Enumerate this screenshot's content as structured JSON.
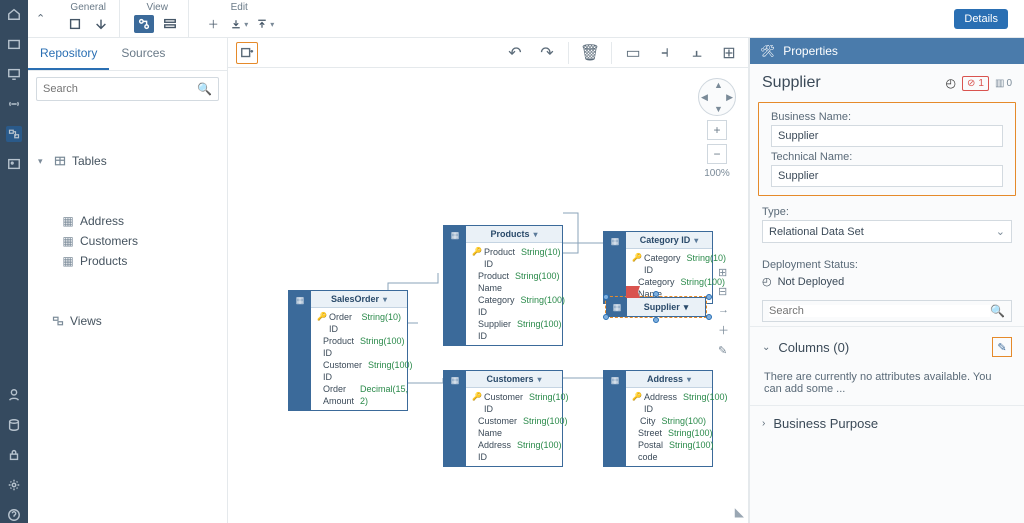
{
  "ribbon": {
    "groups": [
      {
        "label": "General",
        "expanded": true
      },
      {
        "label": "View"
      },
      {
        "label": "Edit"
      }
    ],
    "details_btn": "Details"
  },
  "sidebar": {
    "tabs": [
      "Repository",
      "Sources"
    ],
    "active_tab": 0,
    "search_placeholder": "Search",
    "tree": {
      "tables_label": "Tables",
      "tables": [
        "Address",
        "Customers",
        "Products"
      ],
      "views_label": "Views"
    }
  },
  "canvas": {
    "zoom": "100%",
    "entities": {
      "salesorder": {
        "title": "SalesOrder",
        "cols": [
          [
            "Order ID",
            "String(10)",
            true
          ],
          [
            "Product ID",
            "String(100)",
            false
          ],
          [
            "Customer ID",
            "String(100)",
            false
          ],
          [
            "Order Amount",
            "Decimal(15, 2)",
            false
          ]
        ]
      },
      "products": {
        "title": "Products",
        "cols": [
          [
            "Product ID",
            "String(10)",
            true
          ],
          [
            "Product Name",
            "String(100)",
            false
          ],
          [
            "Category ID",
            "String(100)",
            false
          ],
          [
            "Supplier ID",
            "String(100)",
            false
          ]
        ]
      },
      "customers": {
        "title": "Customers",
        "cols": [
          [
            "Customer ID",
            "String(10)",
            true
          ],
          [
            "Customer Name",
            "String(100)",
            false
          ],
          [
            "Address ID",
            "String(100)",
            false
          ]
        ]
      },
      "category": {
        "title": "Category ID",
        "cols": [
          [
            "Category ID",
            "String(10)",
            true
          ],
          [
            "Category Name",
            "String(100)",
            false
          ]
        ]
      },
      "address": {
        "title": "Address",
        "cols": [
          [
            "Address ID",
            "String(100)",
            true
          ],
          [
            "City",
            "String(100)",
            false
          ],
          [
            "Street",
            "String(100)",
            false
          ],
          [
            "Postal code",
            "String(100)",
            false
          ]
        ]
      },
      "supplier": {
        "title": "Supplier"
      }
    }
  },
  "properties": {
    "header": "Properties",
    "title": "Supplier",
    "error_count": "1",
    "col_count": "0",
    "business_name_label": "Business Name:",
    "business_name_value": "Supplier",
    "technical_name_label": "Technical Name:",
    "technical_name_value": "Supplier",
    "type_label": "Type:",
    "type_value": "Relational Data Set",
    "deploy_label": "Deployment Status:",
    "deploy_value": "Not Deployed",
    "search_placeholder": "Search",
    "columns_section": "Columns (0)",
    "columns_empty": "There are currently no attributes available. You can add some ...",
    "purpose_section": "Business Purpose"
  }
}
